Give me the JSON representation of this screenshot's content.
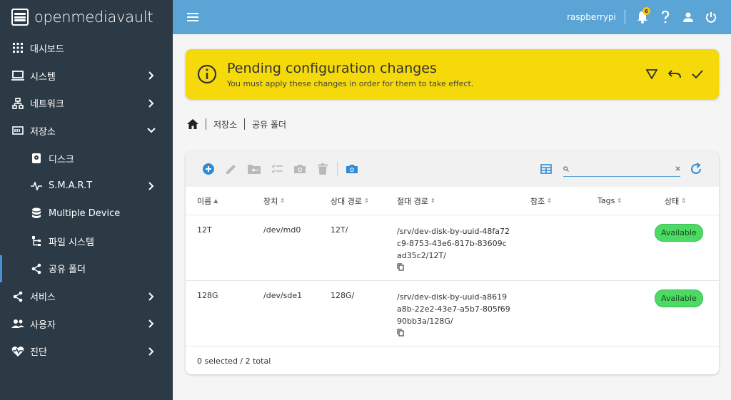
{
  "app": {
    "brand": "openmediavault",
    "hostname": "raspberrypi",
    "notification_count": "6"
  },
  "sidebar": {
    "items": [
      {
        "label": "대시보드",
        "icon": "grid-icon",
        "chevron": ""
      },
      {
        "label": "시스템",
        "icon": "laptop-icon",
        "chevron": "right"
      },
      {
        "label": "네트워크",
        "icon": "network-icon",
        "chevron": "right"
      },
      {
        "label": "저장소",
        "icon": "storage-icon",
        "chevron": "down"
      },
      {
        "label": "디스크",
        "icon": "disk-icon",
        "chevron": "",
        "sub": true
      },
      {
        "label": "S.M.A.R.T",
        "icon": "pulse-icon",
        "chevron": "right",
        "sub": true
      },
      {
        "label": "Multiple Device",
        "icon": "database-icon",
        "chevron": "",
        "sub": true
      },
      {
        "label": "파일 시스템",
        "icon": "tree-icon",
        "chevron": "",
        "sub": true
      },
      {
        "label": "공유 폴더",
        "icon": "share-icon",
        "chevron": "",
        "sub": true,
        "active": true
      },
      {
        "label": "서비스",
        "icon": "share-icon",
        "chevron": "right"
      },
      {
        "label": "사용자",
        "icon": "users-icon",
        "chevron": "right"
      },
      {
        "label": "진단",
        "icon": "heartbeat-icon",
        "chevron": "right"
      }
    ]
  },
  "banner": {
    "title": "Pending configuration changes",
    "subtitle": "You must apply these changes in order for them to take effect."
  },
  "breadcrumb": {
    "items": [
      "저장소",
      "공유 폴더"
    ]
  },
  "table": {
    "search_placeholder": "",
    "columns": [
      "이름",
      "장치",
      "상대 경로",
      "절대 경로",
      "참조",
      "Tags",
      "상태"
    ],
    "rows": [
      {
        "name": "12T",
        "device": "/dev/md0",
        "relpath": "12T/",
        "abspath": "/srv/dev-disk-by-uuid-48fa72c9-8753-43e6-817b-83609cad35c2/12T/",
        "ref": "",
        "tags": "",
        "status": "Available"
      },
      {
        "name": "128G",
        "device": "/dev/sde1",
        "relpath": "128G/",
        "abspath": "/srv/dev-disk-by-uuid-a8619a8b-22e2-43e7-a5b7-805f6990bb3a/128G/",
        "ref": "",
        "tags": "",
        "status": "Available"
      }
    ],
    "footer": "0 selected / 2 total"
  },
  "colors": {
    "sidebar": "#2c3a45",
    "topbar": "#5aa5d6",
    "banner": "#f5d90a",
    "status_available": "#4cd964",
    "accent": "#2f8bd6"
  }
}
